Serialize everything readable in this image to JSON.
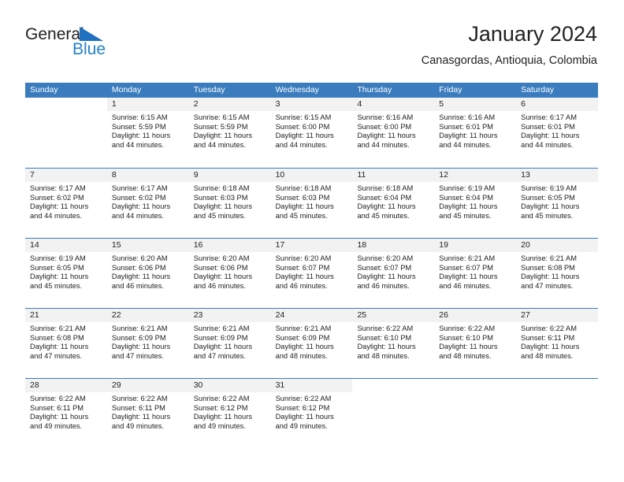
{
  "brand": {
    "name_part1": "General",
    "name_part2": "Blue",
    "triangle_color": "#1f70c1",
    "blue_color": "#2282c8"
  },
  "header": {
    "title": "January 2024",
    "subtitle": "Canasgordas, Antioquia, Colombia"
  },
  "theme": {
    "header_blue": "#3a7cbe",
    "day_number_band": "#f2f2f2",
    "text": "#222222"
  },
  "calendar": {
    "weekday_headers": [
      "Sunday",
      "Monday",
      "Tuesday",
      "Wednesday",
      "Thursday",
      "Friday",
      "Saturday"
    ],
    "weeks": [
      [
        {
          "day": "",
          "sunrise": "",
          "sunset": "",
          "daylight1": "",
          "daylight2": ""
        },
        {
          "day": "1",
          "sunrise": "Sunrise: 6:15 AM",
          "sunset": "Sunset: 5:59 PM",
          "daylight1": "Daylight: 11 hours",
          "daylight2": "and 44 minutes."
        },
        {
          "day": "2",
          "sunrise": "Sunrise: 6:15 AM",
          "sunset": "Sunset: 5:59 PM",
          "daylight1": "Daylight: 11 hours",
          "daylight2": "and 44 minutes."
        },
        {
          "day": "3",
          "sunrise": "Sunrise: 6:15 AM",
          "sunset": "Sunset: 6:00 PM",
          "daylight1": "Daylight: 11 hours",
          "daylight2": "and 44 minutes."
        },
        {
          "day": "4",
          "sunrise": "Sunrise: 6:16 AM",
          "sunset": "Sunset: 6:00 PM",
          "daylight1": "Daylight: 11 hours",
          "daylight2": "and 44 minutes."
        },
        {
          "day": "5",
          "sunrise": "Sunrise: 6:16 AM",
          "sunset": "Sunset: 6:01 PM",
          "daylight1": "Daylight: 11 hours",
          "daylight2": "and 44 minutes."
        },
        {
          "day": "6",
          "sunrise": "Sunrise: 6:17 AM",
          "sunset": "Sunset: 6:01 PM",
          "daylight1": "Daylight: 11 hours",
          "daylight2": "and 44 minutes."
        }
      ],
      [
        {
          "day": "7",
          "sunrise": "Sunrise: 6:17 AM",
          "sunset": "Sunset: 6:02 PM",
          "daylight1": "Daylight: 11 hours",
          "daylight2": "and 44 minutes."
        },
        {
          "day": "8",
          "sunrise": "Sunrise: 6:17 AM",
          "sunset": "Sunset: 6:02 PM",
          "daylight1": "Daylight: 11 hours",
          "daylight2": "and 44 minutes."
        },
        {
          "day": "9",
          "sunrise": "Sunrise: 6:18 AM",
          "sunset": "Sunset: 6:03 PM",
          "daylight1": "Daylight: 11 hours",
          "daylight2": "and 45 minutes."
        },
        {
          "day": "10",
          "sunrise": "Sunrise: 6:18 AM",
          "sunset": "Sunset: 6:03 PM",
          "daylight1": "Daylight: 11 hours",
          "daylight2": "and 45 minutes."
        },
        {
          "day": "11",
          "sunrise": "Sunrise: 6:18 AM",
          "sunset": "Sunset: 6:04 PM",
          "daylight1": "Daylight: 11 hours",
          "daylight2": "and 45 minutes."
        },
        {
          "day": "12",
          "sunrise": "Sunrise: 6:19 AM",
          "sunset": "Sunset: 6:04 PM",
          "daylight1": "Daylight: 11 hours",
          "daylight2": "and 45 minutes."
        },
        {
          "day": "13",
          "sunrise": "Sunrise: 6:19 AM",
          "sunset": "Sunset: 6:05 PM",
          "daylight1": "Daylight: 11 hours",
          "daylight2": "and 45 minutes."
        }
      ],
      [
        {
          "day": "14",
          "sunrise": "Sunrise: 6:19 AM",
          "sunset": "Sunset: 6:05 PM",
          "daylight1": "Daylight: 11 hours",
          "daylight2": "and 45 minutes."
        },
        {
          "day": "15",
          "sunrise": "Sunrise: 6:20 AM",
          "sunset": "Sunset: 6:06 PM",
          "daylight1": "Daylight: 11 hours",
          "daylight2": "and 46 minutes."
        },
        {
          "day": "16",
          "sunrise": "Sunrise: 6:20 AM",
          "sunset": "Sunset: 6:06 PM",
          "daylight1": "Daylight: 11 hours",
          "daylight2": "and 46 minutes."
        },
        {
          "day": "17",
          "sunrise": "Sunrise: 6:20 AM",
          "sunset": "Sunset: 6:07 PM",
          "daylight1": "Daylight: 11 hours",
          "daylight2": "and 46 minutes."
        },
        {
          "day": "18",
          "sunrise": "Sunrise: 6:20 AM",
          "sunset": "Sunset: 6:07 PM",
          "daylight1": "Daylight: 11 hours",
          "daylight2": "and 46 minutes."
        },
        {
          "day": "19",
          "sunrise": "Sunrise: 6:21 AM",
          "sunset": "Sunset: 6:07 PM",
          "daylight1": "Daylight: 11 hours",
          "daylight2": "and 46 minutes."
        },
        {
          "day": "20",
          "sunrise": "Sunrise: 6:21 AM",
          "sunset": "Sunset: 6:08 PM",
          "daylight1": "Daylight: 11 hours",
          "daylight2": "and 47 minutes."
        }
      ],
      [
        {
          "day": "21",
          "sunrise": "Sunrise: 6:21 AM",
          "sunset": "Sunset: 6:08 PM",
          "daylight1": "Daylight: 11 hours",
          "daylight2": "and 47 minutes."
        },
        {
          "day": "22",
          "sunrise": "Sunrise: 6:21 AM",
          "sunset": "Sunset: 6:09 PM",
          "daylight1": "Daylight: 11 hours",
          "daylight2": "and 47 minutes."
        },
        {
          "day": "23",
          "sunrise": "Sunrise: 6:21 AM",
          "sunset": "Sunset: 6:09 PM",
          "daylight1": "Daylight: 11 hours",
          "daylight2": "and 47 minutes."
        },
        {
          "day": "24",
          "sunrise": "Sunrise: 6:21 AM",
          "sunset": "Sunset: 6:09 PM",
          "daylight1": "Daylight: 11 hours",
          "daylight2": "and 48 minutes."
        },
        {
          "day": "25",
          "sunrise": "Sunrise: 6:22 AM",
          "sunset": "Sunset: 6:10 PM",
          "daylight1": "Daylight: 11 hours",
          "daylight2": "and 48 minutes."
        },
        {
          "day": "26",
          "sunrise": "Sunrise: 6:22 AM",
          "sunset": "Sunset: 6:10 PM",
          "daylight1": "Daylight: 11 hours",
          "daylight2": "and 48 minutes."
        },
        {
          "day": "27",
          "sunrise": "Sunrise: 6:22 AM",
          "sunset": "Sunset: 6:11 PM",
          "daylight1": "Daylight: 11 hours",
          "daylight2": "and 48 minutes."
        }
      ],
      [
        {
          "day": "28",
          "sunrise": "Sunrise: 6:22 AM",
          "sunset": "Sunset: 6:11 PM",
          "daylight1": "Daylight: 11 hours",
          "daylight2": "and 49 minutes."
        },
        {
          "day": "29",
          "sunrise": "Sunrise: 6:22 AM",
          "sunset": "Sunset: 6:11 PM",
          "daylight1": "Daylight: 11 hours",
          "daylight2": "and 49 minutes."
        },
        {
          "day": "30",
          "sunrise": "Sunrise: 6:22 AM",
          "sunset": "Sunset: 6:12 PM",
          "daylight1": "Daylight: 11 hours",
          "daylight2": "and 49 minutes."
        },
        {
          "day": "31",
          "sunrise": "Sunrise: 6:22 AM",
          "sunset": "Sunset: 6:12 PM",
          "daylight1": "Daylight: 11 hours",
          "daylight2": "and 49 minutes."
        },
        {
          "day": "",
          "sunrise": "",
          "sunset": "",
          "daylight1": "",
          "daylight2": ""
        },
        {
          "day": "",
          "sunrise": "",
          "sunset": "",
          "daylight1": "",
          "daylight2": ""
        },
        {
          "day": "",
          "sunrise": "",
          "sunset": "",
          "daylight1": "",
          "daylight2": ""
        }
      ]
    ]
  }
}
